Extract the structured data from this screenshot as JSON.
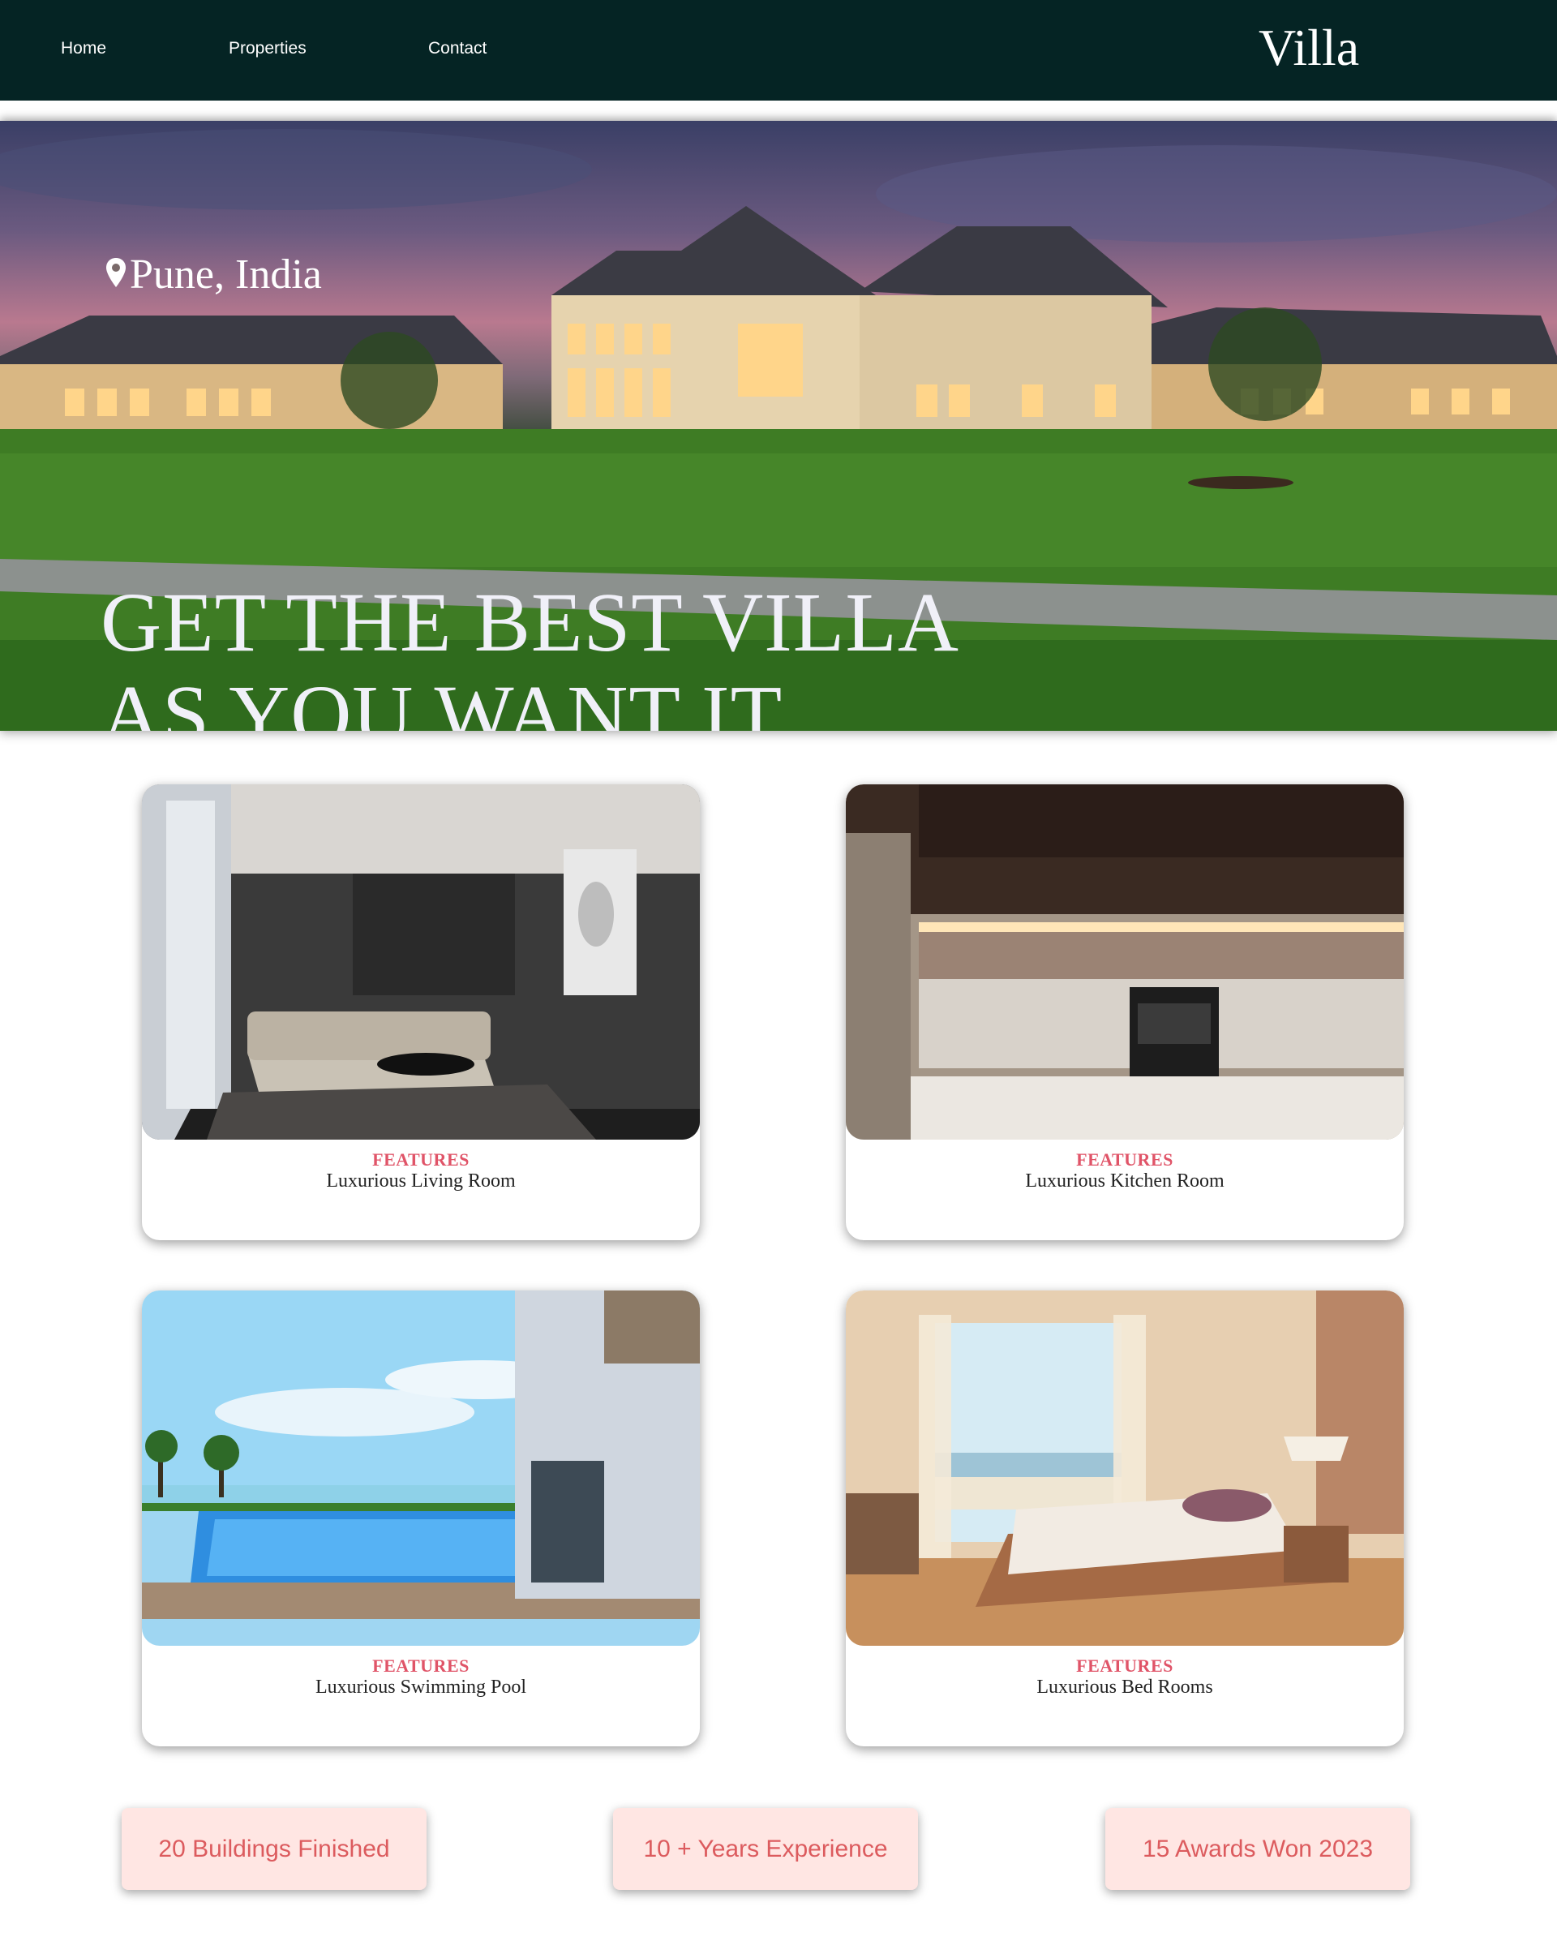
{
  "nav": {
    "links": [
      "Home",
      "Properties",
      "Contact"
    ],
    "brand": "Villa"
  },
  "hero": {
    "location": "Pune, India",
    "location_icon": "map-pin-icon",
    "headline_line1": "GET THE BEST VILLA",
    "headline_line2": "AS YOU WANT IT"
  },
  "features": [
    {
      "title": "FEATURES",
      "text": "Luxurious Living Room",
      "image": "living-room-photo"
    },
    {
      "title": "FEATURES",
      "text": "Luxurious Kitchen Room",
      "image": "kitchen-photo"
    },
    {
      "title": "FEATURES",
      "text": "Luxurious Swimming Pool",
      "image": "pool-photo"
    },
    {
      "title": "FEATURES",
      "text": "Luxurious Bed Rooms",
      "image": "bedroom-photo"
    }
  ],
  "stats": [
    "20 Buildings Finished",
    "10 + Years Experience",
    "15 Awards Won 2023"
  ],
  "colors": {
    "nav_bg": "#052424",
    "accent": "#e05468",
    "stat_bg": "#ffe6e3",
    "stat_text": "#dc5b5e"
  }
}
